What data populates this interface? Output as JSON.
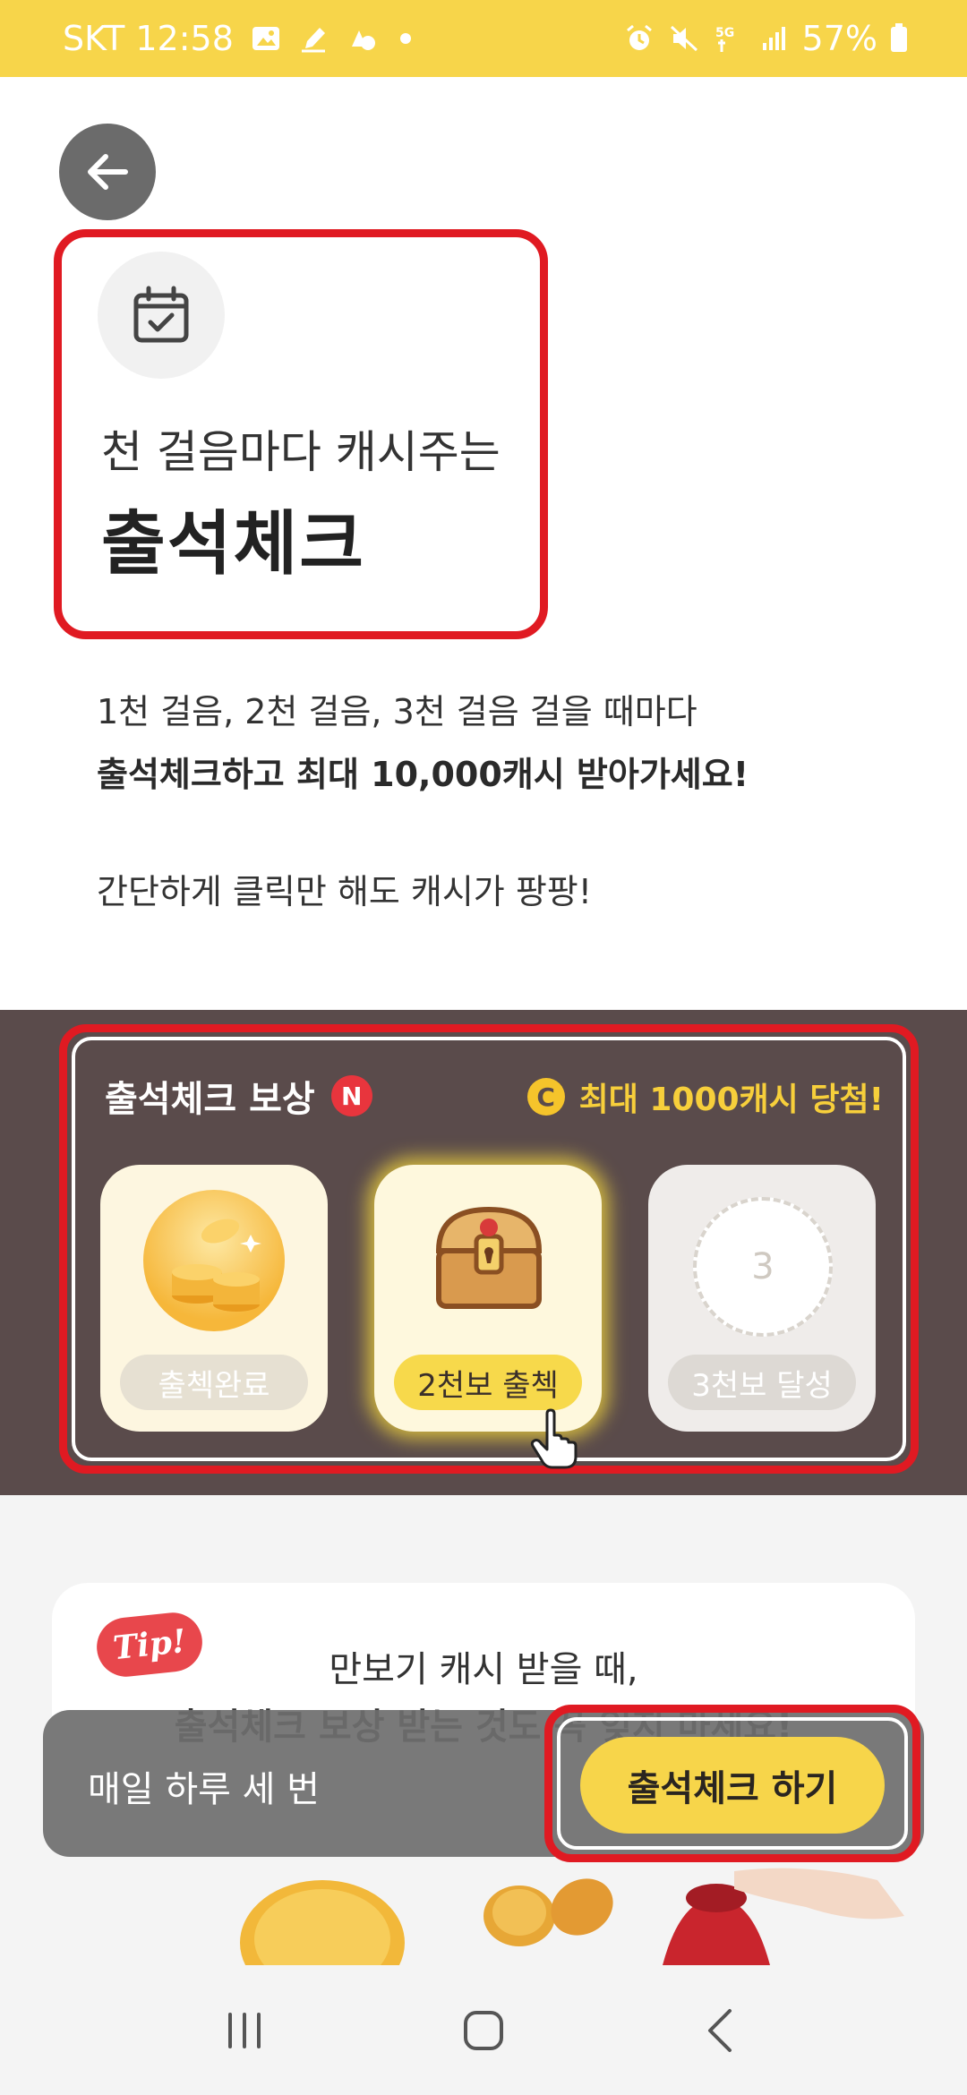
{
  "status_bar": {
    "carrier_time": "SKT 12:58",
    "battery": "57%",
    "left_icons": [
      "image-icon",
      "pen-icon",
      "cloud-icon",
      "dot"
    ],
    "right_icons": [
      "alarm-icon",
      "mute-icon",
      "5g-icon",
      "signal-icon",
      "battery-icon"
    ]
  },
  "header": {
    "subtitle": "천 걸음마다 캐시주는",
    "title": "출석체크",
    "icon": "calendar-check-icon"
  },
  "description": {
    "line1": "1천 걸음, 2천 걸음, 3천 걸음 걸을 때마다",
    "line2": "출석체크하고 최대 10,000캐시 받아가세요!",
    "line3": "간단하게 클릭만 해도 캐시가 팡팡!"
  },
  "reward": {
    "title": "출석체크 보상",
    "new_badge": "N",
    "coin_badge": "C",
    "max_text": "최대 1000캐시 당첨!",
    "cards": [
      {
        "label": "출첵완료",
        "state": "done"
      },
      {
        "label": "2천보 출첵",
        "state": "active"
      },
      {
        "label": "3천보 달성",
        "state": "locked",
        "number": "3"
      }
    ]
  },
  "tip": {
    "badge": "Tip!",
    "line1": "만보기 캐시 받을 때,",
    "line2": "출석체크 보상 받는 것도 꼭 잊지 마세요!"
  },
  "bottom_bar": {
    "text": "매일 하루 세 번",
    "button": "출석체크 하기"
  },
  "colors": {
    "accent_yellow": "#f7d54a",
    "highlight_red": "#e01a22",
    "panel_brown": "#5a4b4b",
    "max_text_yellow": "#f7cf3b"
  },
  "nav": [
    "recents-icon",
    "home-icon",
    "back-icon"
  ]
}
